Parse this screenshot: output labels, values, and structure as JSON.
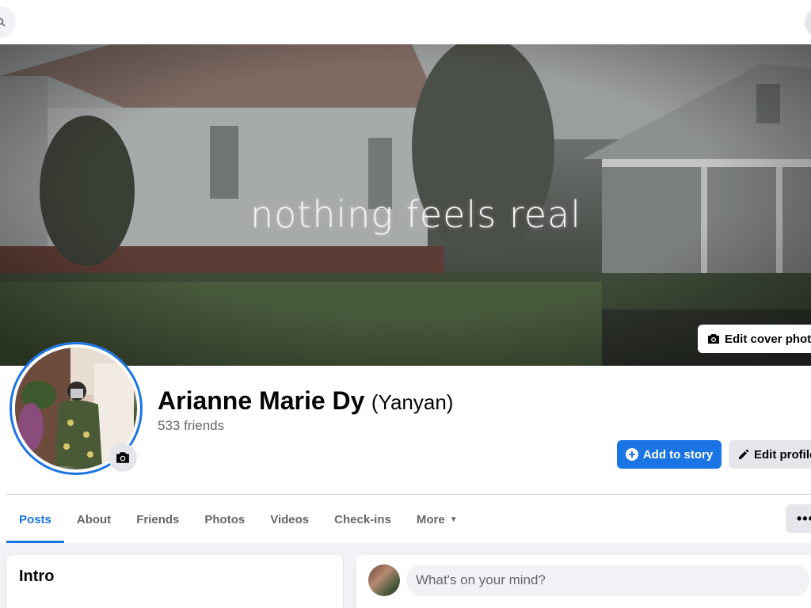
{
  "profile": {
    "cover_text": "nothing feels real",
    "edit_cover_label": "Edit cover photo",
    "name": "Arianne Marie Dy",
    "alt_name": "(Yanyan)",
    "friends": "533 friends",
    "add_story_label": "Add to story",
    "edit_profile_label": "Edit profile"
  },
  "tabs": [
    {
      "label": "Posts",
      "active": true
    },
    {
      "label": "About"
    },
    {
      "label": "Friends"
    },
    {
      "label": "Photos"
    },
    {
      "label": "Videos"
    },
    {
      "label": "Check-ins"
    },
    {
      "label": "More"
    }
  ],
  "more_menu_label": "•••",
  "intro": {
    "title": "Intro"
  },
  "composer": {
    "placeholder": "What's on your mind?"
  },
  "colors": {
    "accent": "#1b74e4",
    "page_bg": "#f0f2f5",
    "button_gray": "#e4e6eb"
  },
  "icons": [
    "search-icon",
    "camera-icon",
    "plus-circle-icon",
    "pencil-icon",
    "caret-down-icon",
    "more-dots-icon"
  ]
}
